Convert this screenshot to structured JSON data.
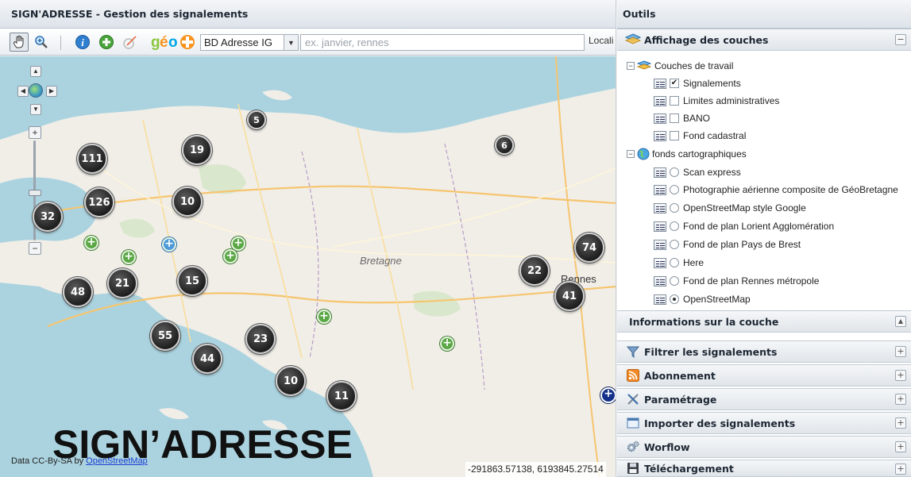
{
  "map_panel": {
    "title": "SIGN'ADRESSE - Gestion des signalements",
    "layer_select": {
      "value": "BD Adresse IG"
    },
    "search": {
      "placeholder": "ex. janvier, rennes"
    },
    "locate_label": "Locali",
    "attribution_prefix": "Data CC-By-SA by ",
    "attribution_link": "OpenStreetMap",
    "coordinates": "-291863.57138, 6193845.27514",
    "brand_overlay": "SIGN’ADRESSE",
    "region_label": "Bretagne",
    "city_label": "Rennes",
    "toolbar_icons": [
      "pan-hand-icon",
      "zoom-in-icon",
      "info-icon",
      "add-report-icon",
      "measure-icon",
      "geo-logo-icon"
    ]
  },
  "clusters": [
    {
      "count": "5",
      "size": "small"
    },
    {
      "count": "6",
      "size": "small"
    },
    {
      "count": "111",
      "size": "large"
    },
    {
      "count": "19",
      "size": "large"
    },
    {
      "count": "126",
      "size": "large"
    },
    {
      "count": "10",
      "size": "large"
    },
    {
      "count": "32",
      "size": "large"
    },
    {
      "count": "74",
      "size": "large"
    },
    {
      "count": "22",
      "size": "large"
    },
    {
      "count": "41",
      "size": "large"
    },
    {
      "count": "48",
      "size": "large"
    },
    {
      "count": "21",
      "size": "large"
    },
    {
      "count": "15",
      "size": "large"
    },
    {
      "count": "55",
      "size": "large"
    },
    {
      "count": "44",
      "size": "large"
    },
    {
      "count": "23",
      "size": "large"
    },
    {
      "count": "10",
      "size": "large"
    },
    {
      "count": "11",
      "size": "large"
    }
  ],
  "tools_panel": {
    "title": "Outils",
    "display_layers": {
      "label": "Affichage des couches",
      "groups": [
        {
          "label": "Couches de travail",
          "layers": [
            {
              "label": "Signalements",
              "checked": true
            },
            {
              "label": "Limites administratives",
              "checked": false
            },
            {
              "label": "BANO",
              "checked": false
            },
            {
              "label": "Fond cadastral",
              "checked": false
            }
          ]
        },
        {
          "label": "fonds cartographiques",
          "layers": [
            {
              "label": "Scan express",
              "selected": false
            },
            {
              "label": "Photographie aérienne composite de GéoBretagne",
              "selected": false
            },
            {
              "label": "OpenStreetMap style Google",
              "selected": false
            },
            {
              "label": "Fond de plan Lorient Agglomération",
              "selected": false
            },
            {
              "label": "Fond de plan Pays de Brest",
              "selected": false
            },
            {
              "label": "Here",
              "selected": false
            },
            {
              "label": "Fond de plan Rennes métropole",
              "selected": false
            },
            {
              "label": "OpenStreetMap",
              "selected": true
            }
          ]
        }
      ]
    },
    "layer_info": {
      "label": "Informations sur la couche"
    },
    "sections": [
      {
        "label": "Filtrer les signalements",
        "icon": "filter-icon"
      },
      {
        "label": "Abonnement",
        "icon": "rss-icon"
      },
      {
        "label": "Paramétrage",
        "icon": "tools-icon"
      },
      {
        "label": "Importer des signalements",
        "icon": "import-icon"
      },
      {
        "label": "Worflow",
        "icon": "gears-icon"
      },
      {
        "label": "Téléchargement",
        "icon": "save-icon"
      }
    ],
    "toggle_collapse": "−",
    "toggle_expand": "+"
  },
  "colors": {
    "sea": "#abd3df",
    "land": "#f1eee8",
    "cluster": "#2a2a2a",
    "marker_green": "#5aa745",
    "marker_blue": "#4d9ad8"
  }
}
